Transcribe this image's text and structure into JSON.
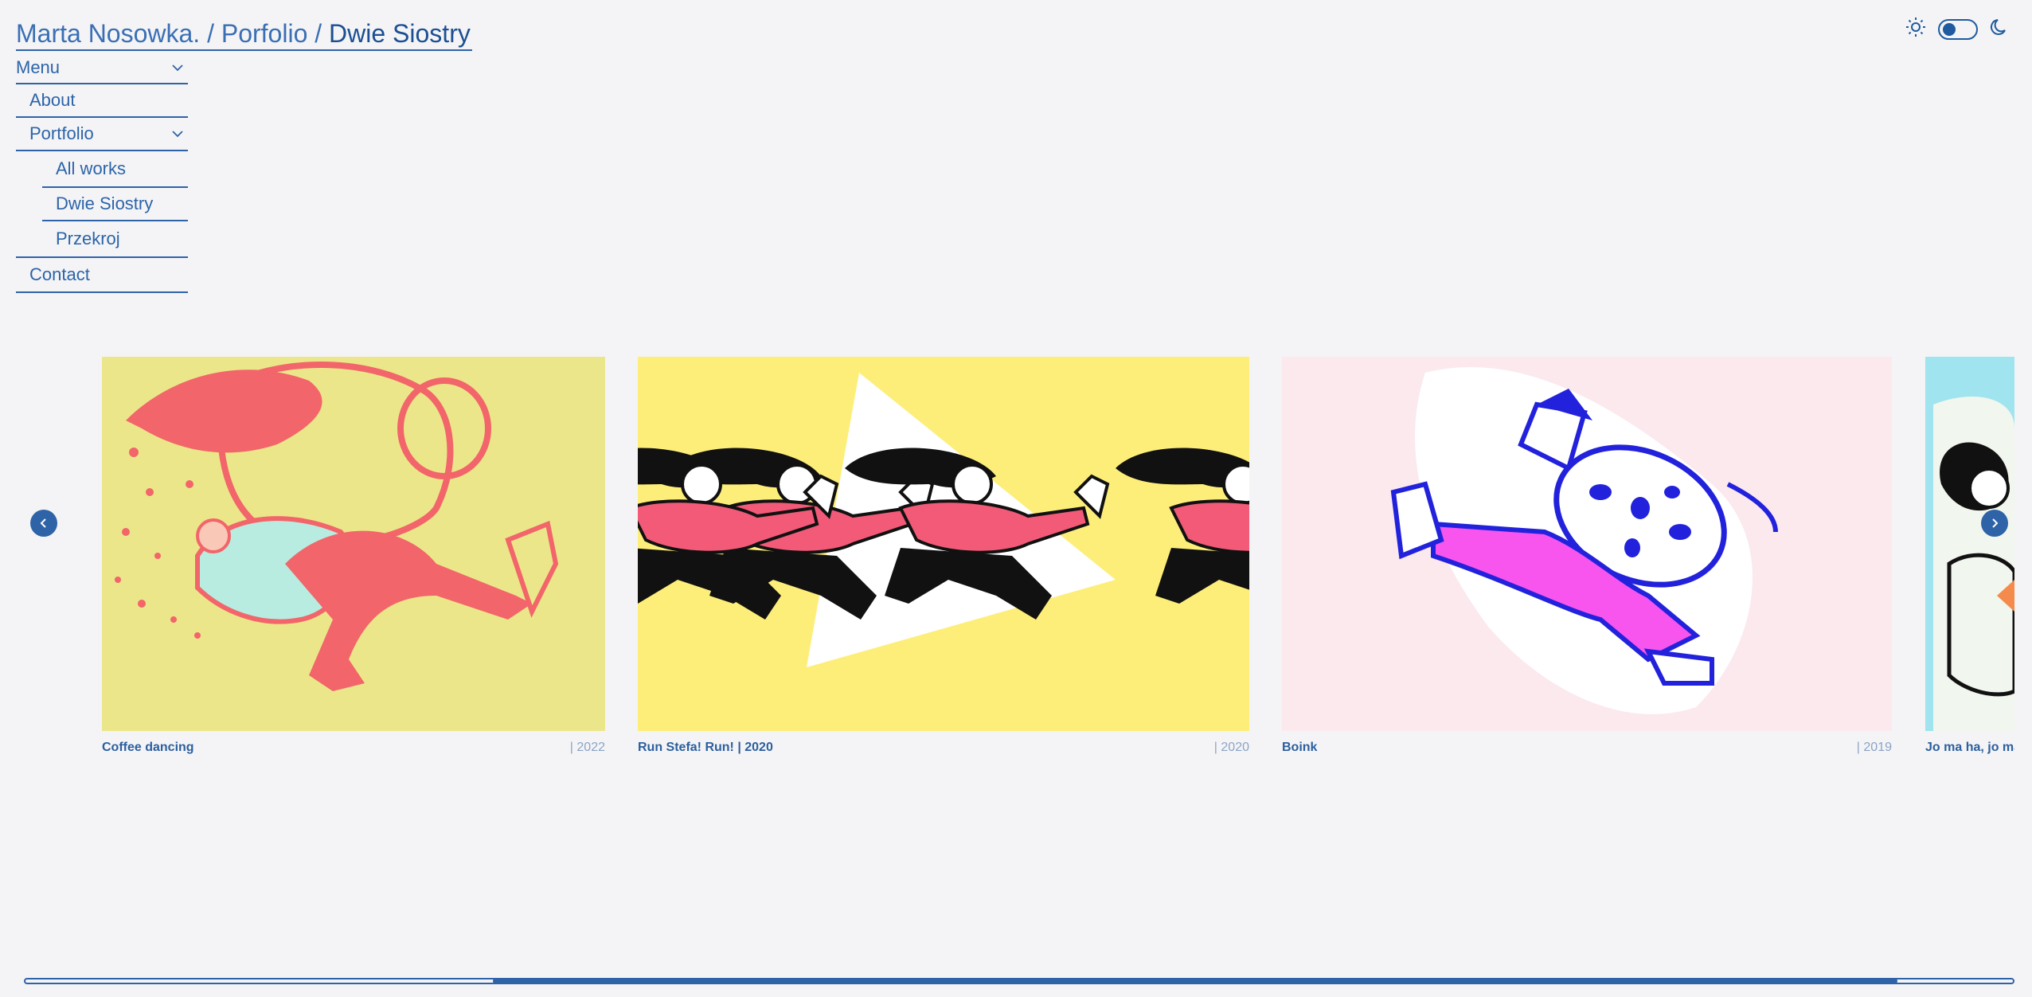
{
  "breadcrumb": {
    "author": "Marta Nosowka.",
    "sep1": " / ",
    "section": "Porfolio",
    "sep2": " / ",
    "current": "Dwie Siostry"
  },
  "theme": {
    "light_icon": "sun-icon",
    "dark_icon": "moon-icon",
    "mode": "light"
  },
  "menu": {
    "toggle_label": "Menu",
    "items": [
      {
        "label": "About"
      },
      {
        "label": "Portfolio"
      },
      {
        "label": "All works"
      },
      {
        "label": "Dwie Siostry"
      },
      {
        "label": "Przekroj"
      },
      {
        "label": "Contact"
      }
    ]
  },
  "gallery": {
    "cards": [
      {
        "title": "Coffee dancing",
        "year": "| 2022",
        "bg": "#ece68a"
      },
      {
        "title": "Run Stefa! Run! | 2020",
        "year": "| 2020",
        "bg": "#fdee7a"
      },
      {
        "title": "Boink",
        "year": "| 2019",
        "bg": "#fbe9ee"
      },
      {
        "title": "Jo ma ha, jo ma h",
        "year": "",
        "bg": "#9fe4ee"
      }
    ],
    "scroll_progress": {
      "start": 0.235,
      "end": 0.942
    }
  }
}
